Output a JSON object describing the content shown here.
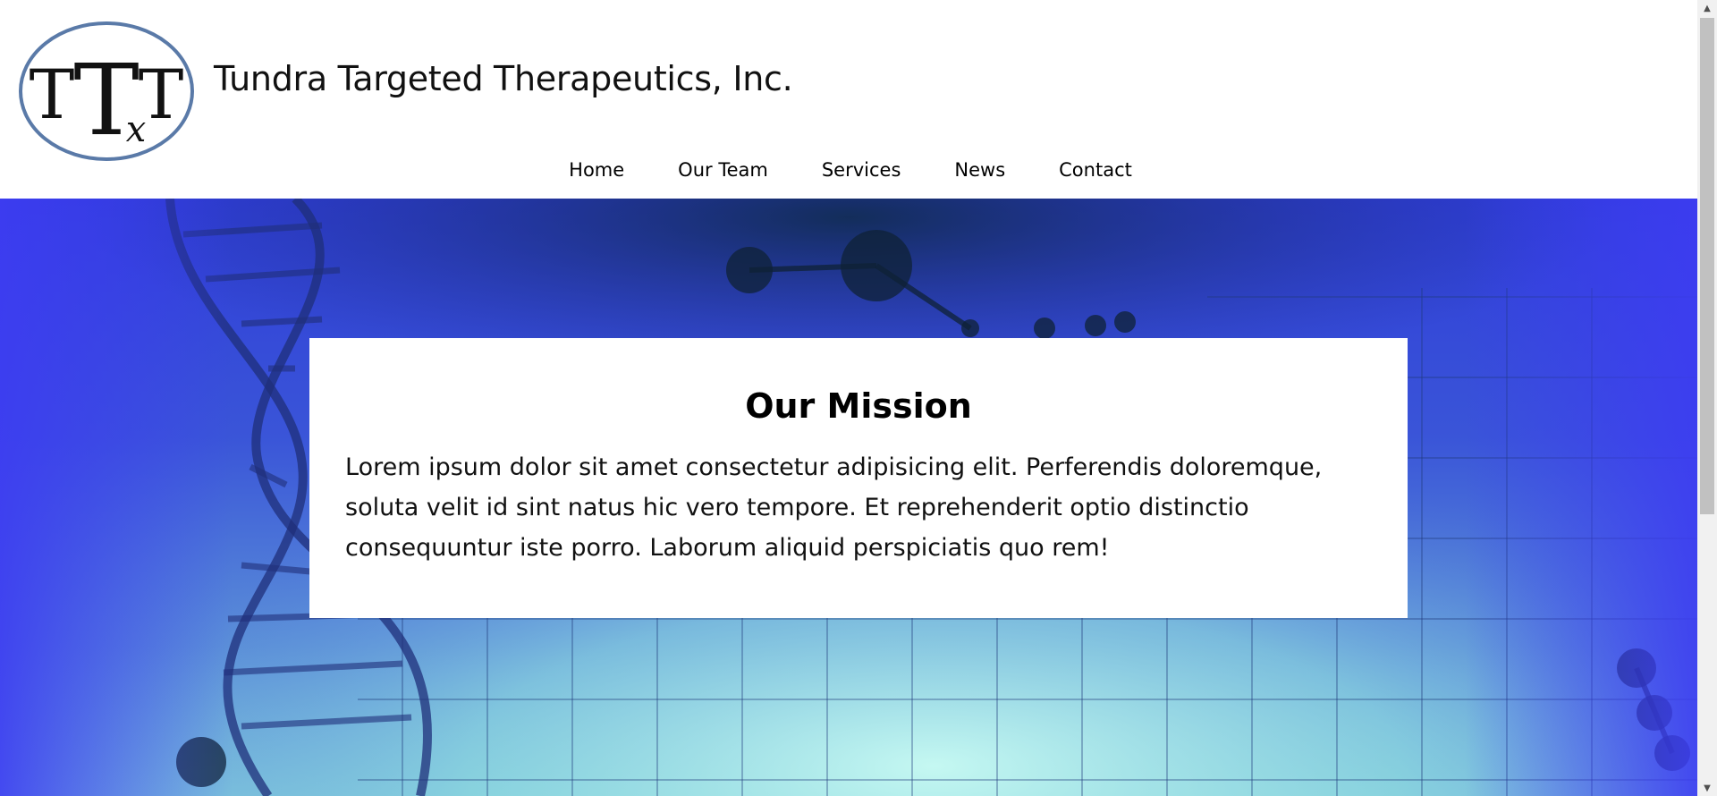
{
  "header": {
    "logo_letters": "TTTx",
    "site_title": "Tundra Targeted Therapeutics, Inc."
  },
  "nav": {
    "items": [
      {
        "label": "Home"
      },
      {
        "label": "Our Team"
      },
      {
        "label": "Services"
      },
      {
        "label": "News"
      },
      {
        "label": "Contact"
      }
    ]
  },
  "mission": {
    "title": "Our Mission",
    "text": "Lorem ipsum dolor sit amet consectetur adipisicing elit. Perferendis doloremque, soluta velit id sint natus hic vero tempore. Et reprehenderit optio distinctio consequuntur iste porro. Laborum aliquid perspiciatis quo rem!"
  },
  "colors": {
    "logo_ring": "#5a7aa8",
    "hero_top": "#2f3dd8",
    "hero_bottom": "#7fc9dc"
  }
}
